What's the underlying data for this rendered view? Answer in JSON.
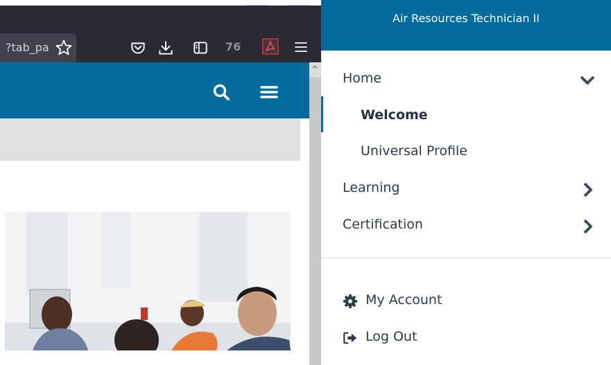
{
  "browser": {
    "url_fragment": "?tab_pa",
    "extension_badge": "76"
  },
  "drawer": {
    "title": "Air Resources Technician II",
    "nav": [
      {
        "label": "Home",
        "expanded": true
      },
      {
        "label": "Welcome",
        "active": true,
        "indent": true
      },
      {
        "label": "Universal Profile",
        "indent": true
      },
      {
        "label": "Learning",
        "expanded": false
      },
      {
        "label": "Certification",
        "expanded": false
      }
    ],
    "account": {
      "my_account": "My Account",
      "log_out": "Log Out"
    }
  },
  "colors": {
    "brand_blue": "#036c9f",
    "firefox_toolbar": "#2b2a33",
    "gray_band": "#e0e0e0",
    "nav_text": "#2b3b4a"
  },
  "icons": {
    "browser": [
      "star-icon",
      "pocket-icon",
      "download-icon",
      "sidebar-icon",
      "pdf-icon",
      "hamburger-icon"
    ],
    "site": [
      "search-icon",
      "menu-icon"
    ],
    "drawer": [
      "chevron-down-icon",
      "chevron-right-icon",
      "gear-icon",
      "sign-out-icon"
    ]
  }
}
